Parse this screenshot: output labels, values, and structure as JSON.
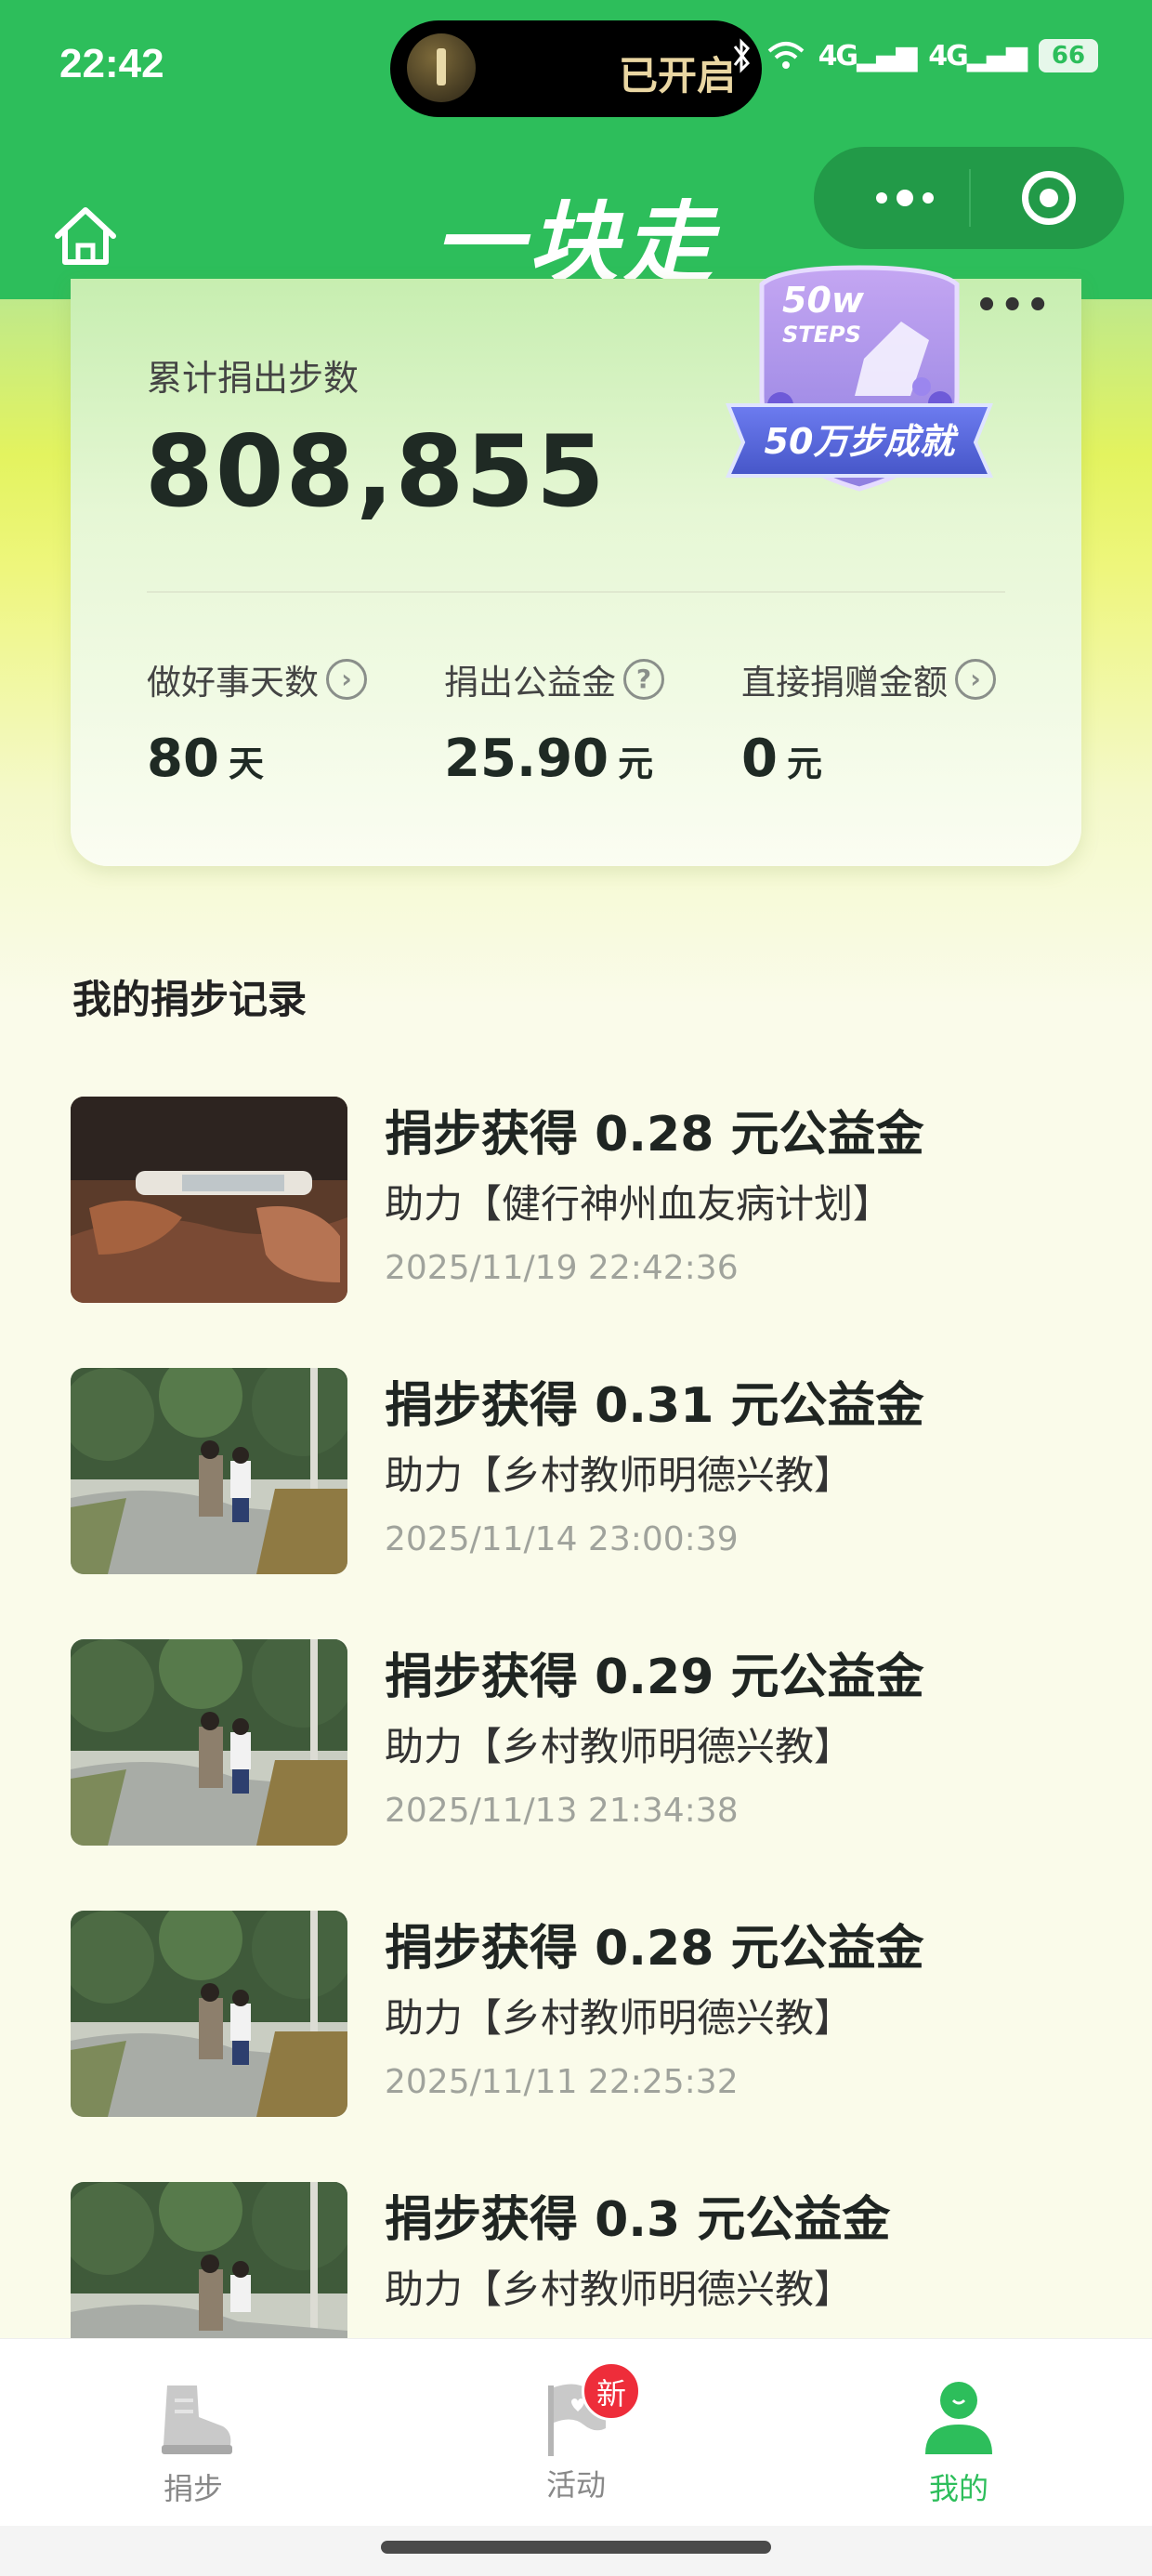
{
  "status_bar": {
    "time": "22:42",
    "island_text": "已开启",
    "network_a": "4G",
    "network_b": "4G",
    "battery": "66"
  },
  "header": {
    "title": "一块走"
  },
  "stats_card": {
    "menu_label": "•••",
    "total_label": "累计捐出步数",
    "total_value": "808,855",
    "badge": {
      "top_text": "50w",
      "steps_text": "STEPS",
      "ribbon_text": "50万步成就"
    },
    "stats": [
      {
        "label": "做好事天数",
        "value": "80",
        "unit": "天"
      },
      {
        "label": "捐出公益金",
        "value": "25.90",
        "unit": "元"
      },
      {
        "label": "直接捐赠金额",
        "value": "0",
        "unit": "元"
      }
    ]
  },
  "records_section": {
    "title": "我的捐步记录",
    "records": [
      {
        "title": "捐步获得 0.28 元公益金",
        "project": "助力【健行神州血友病计划】",
        "time": "2025/11/19 22:42:36",
        "image": "hemophilia"
      },
      {
        "title": "捐步获得 0.31 元公益金",
        "project": "助力【乡村教师明德兴教】",
        "time": "2025/11/14 23:00:39",
        "image": "rural-road"
      },
      {
        "title": "捐步获得 0.29 元公益金",
        "project": "助力【乡村教师明德兴教】",
        "time": "2025/11/13 21:34:38",
        "image": "rural-road"
      },
      {
        "title": "捐步获得 0.28 元公益金",
        "project": "助力【乡村教师明德兴教】",
        "time": "2025/11/11 22:25:32",
        "image": "rural-road"
      },
      {
        "title": "捐步获得 0.3 元公益金",
        "project": "助力【乡村教师明德兴教】",
        "time": "",
        "image": "rural-road"
      }
    ]
  },
  "tabbar": {
    "tabs": [
      {
        "label": "捐步",
        "icon": "shoe-icon"
      },
      {
        "label": "活动",
        "icon": "flag-icon",
        "badge": "新"
      },
      {
        "label": "我的",
        "icon": "user-icon",
        "active": true
      }
    ]
  },
  "colors": {
    "primary_green": "#2dbe5b",
    "badge_red": "#ee2d3a"
  }
}
